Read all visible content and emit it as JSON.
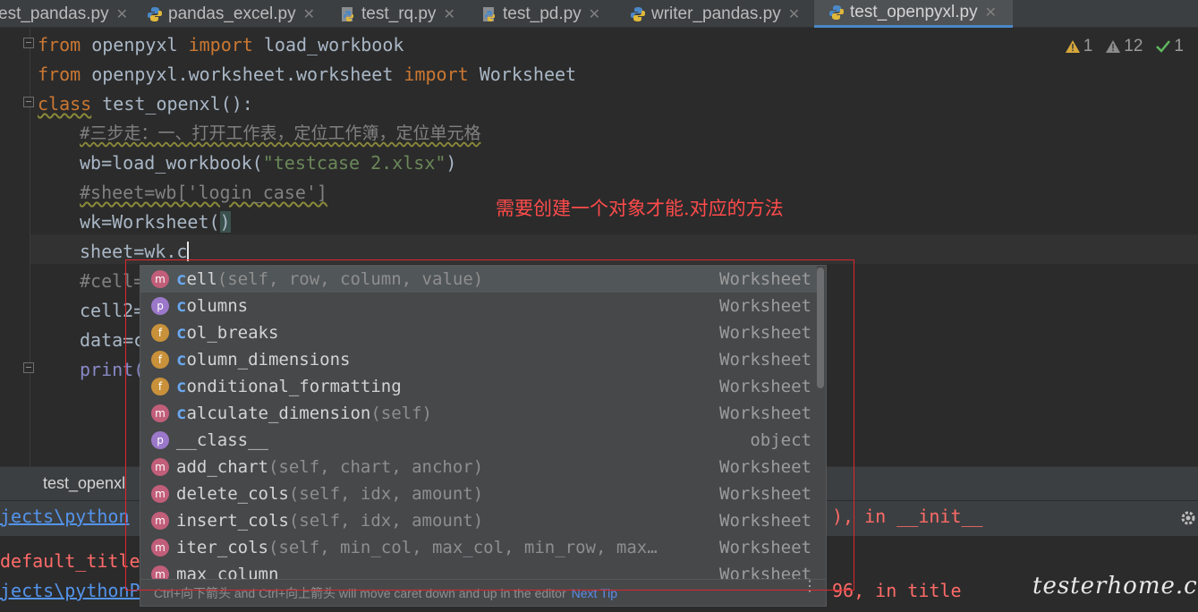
{
  "tabs": [
    {
      "label": "est_pandas.py",
      "active": false
    },
    {
      "label": "pandas_excel.py",
      "active": false
    },
    {
      "label": "test_rq.py",
      "active": false
    },
    {
      "label": "test_pd.py",
      "active": false
    },
    {
      "label": "writer_pandas.py",
      "active": false
    },
    {
      "label": "test_openpyxl.py",
      "active": true
    }
  ],
  "close_glyph": "✕",
  "inspections": {
    "warnings": "1",
    "weak_warnings": "12",
    "ok": "1"
  },
  "code": {
    "l1": {
      "k1": "from",
      "t1": " openpyxl ",
      "k2": "import",
      "t2": " load_workbook"
    },
    "l2": {
      "k1": "from",
      "t1": " openpyxl.worksheet.worksheet ",
      "k2": "import",
      "t2": " Worksheet"
    },
    "l3": {
      "k1": "class",
      "t1": " test_openxl():"
    },
    "l4": "#三步走：一、打开工作表，定位工作簿，定位单元格",
    "l5": {
      "t1": "wb=load_workbook(",
      "s1": "\"testcase 2.xlsx\"",
      "t2": ")"
    },
    "l6": "#sheet=wb['login_case']",
    "l7": {
      "t1": "wk=Worksheet(",
      "t2": ")"
    },
    "l8": "sheet=wk.c",
    "l9": "#cell=",
    "l10": "cell2=",
    "l11": "data=c",
    "l12": "print("
  },
  "annotation": "需要创建一个对象才能.对应的方法",
  "completion": {
    "items": [
      {
        "icon": "m",
        "match": "c",
        "rest": "ell",
        "params": "(self, row, column, value)",
        "owner": "Worksheet"
      },
      {
        "icon": "p",
        "match": "c",
        "rest": "olumns",
        "params": "",
        "owner": "Worksheet"
      },
      {
        "icon": "f",
        "match": "c",
        "rest": "ol_breaks",
        "params": "",
        "owner": "Worksheet"
      },
      {
        "icon": "f",
        "match": "c",
        "rest": "olumn_dimensions",
        "params": "",
        "owner": "Worksheet"
      },
      {
        "icon": "f",
        "match": "c",
        "rest": "onditional_formatting",
        "params": "",
        "owner": "Worksheet"
      },
      {
        "icon": "m",
        "match": "c",
        "rest": "alculate_dimension",
        "params": "(self)",
        "owner": "Worksheet"
      },
      {
        "icon": "p",
        "match": "",
        "rest": "__class__",
        "params": "",
        "owner": "object"
      },
      {
        "icon": "m",
        "match": "",
        "rest": "add_chart",
        "params": "(self, chart, anchor)",
        "owner": "Worksheet"
      },
      {
        "icon": "m",
        "match": "",
        "rest": "delete_cols",
        "params": "(self, idx, amount)",
        "owner": "Worksheet"
      },
      {
        "icon": "m",
        "match": "",
        "rest": "insert_cols",
        "params": "(self, idx, amount)",
        "owner": "Worksheet"
      },
      {
        "icon": "m",
        "match": "",
        "rest": "iter_cols",
        "params": "(self, min_col, max_col, min_row, max…",
        "owner": "Worksheet"
      },
      {
        "icon": "m",
        "match": "",
        "rest": "max_column",
        "params": "",
        "owner": "Worksheet"
      }
    ],
    "footer_text": "Ctrl+向下箭头 and Ctrl+向上箭头 will move caret down and up in the editor",
    "footer_tip": "Next Tip"
  },
  "run_panel": {
    "tab_label": "test_openxl",
    "console": {
      "line1_link": "jects\\python",
      "line1_tail": "), in __init__",
      "line2": "default_title",
      "line3_link": "jects\\pythonPr",
      "line3_tail": "96, in title"
    }
  },
  "watermark": "testerhome.com"
}
